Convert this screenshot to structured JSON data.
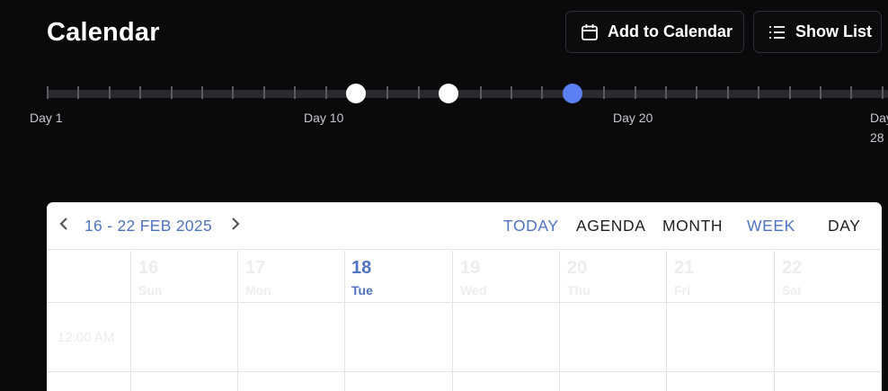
{
  "header": {
    "title": "Calendar",
    "add_label": "Add to Calendar",
    "list_label": "Show List"
  },
  "timeline": {
    "labels": [
      "Day 1",
      "Day 10",
      "Day 20",
      "Day",
      "28"
    ],
    "marker_days": [
      11,
      14,
      18
    ],
    "accent_color": "#5c7ff2"
  },
  "calendar": {
    "range": "16 - 22 FEB 2025",
    "views": [
      "TODAY",
      "AGENDA",
      "MONTH",
      "WEEK",
      "DAY"
    ],
    "active_view": "WEEK",
    "days": [
      {
        "num": "16",
        "name": "Sun"
      },
      {
        "num": "17",
        "name": "Mon"
      },
      {
        "num": "18",
        "name": "Tue"
      },
      {
        "num": "19",
        "name": "Wed"
      },
      {
        "num": "20",
        "name": "Thu"
      },
      {
        "num": "21",
        "name": "Fri"
      },
      {
        "num": "22",
        "name": "Sat"
      }
    ],
    "time_label": "12:00 AM"
  }
}
